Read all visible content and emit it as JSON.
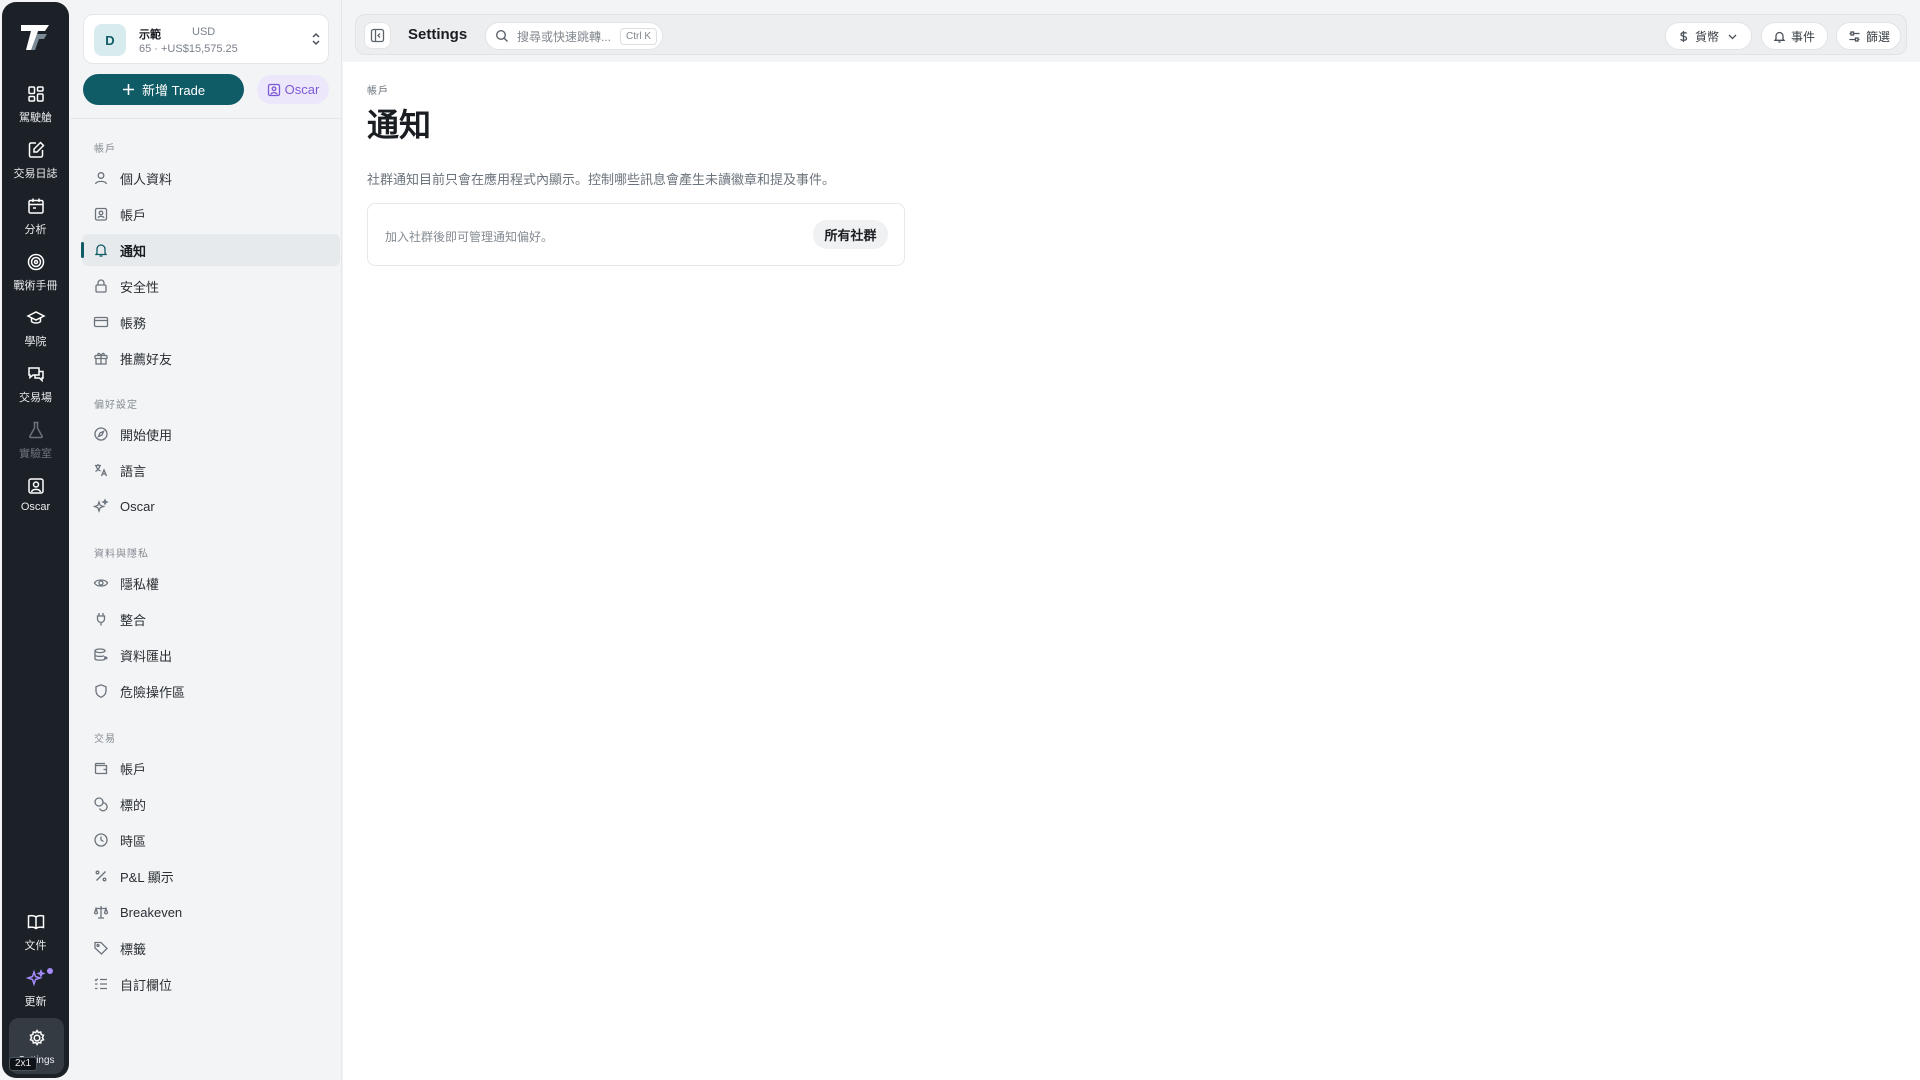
{
  "rail": {
    "items": [
      {
        "label": "駕駛艙",
        "icon": "grid-icon"
      },
      {
        "label": "交易日誌",
        "icon": "journal-edit-icon"
      },
      {
        "label": "分析",
        "icon": "calendar-icon"
      },
      {
        "label": "戰術手冊",
        "icon": "target-icon"
      },
      {
        "label": "學院",
        "icon": "graduation-cap-icon"
      },
      {
        "label": "交易場",
        "icon": "chat-bubbles-icon"
      },
      {
        "label": "實驗室",
        "icon": "flask-icon"
      },
      {
        "label": "Oscar",
        "icon": "assistant-icon"
      }
    ],
    "docs_label": "文件",
    "updates_label": "更新",
    "settings_label": "Settings",
    "zoom_badge": "2x1",
    "accent_color": "#a78bfa"
  },
  "account": {
    "avatar_letter": "D",
    "name": "示範",
    "currency": "USD",
    "balance": "65 · +US$15,575.25"
  },
  "actions": {
    "new_trade": "新增 Trade",
    "oscar": "Oscar"
  },
  "sidebar": {
    "sections": [
      {
        "label": "帳戶",
        "items": [
          {
            "label": "個人資料",
            "icon": "user-icon"
          },
          {
            "label": "帳戶",
            "icon": "id-badge-icon"
          },
          {
            "label": "通知",
            "icon": "bell-icon",
            "active": true
          },
          {
            "label": "安全性",
            "icon": "lock-icon"
          },
          {
            "label": "帳務",
            "icon": "credit-card-icon"
          },
          {
            "label": "推薦好友",
            "icon": "gift-icon"
          }
        ]
      },
      {
        "label": "偏好設定",
        "items": [
          {
            "label": "開始使用",
            "icon": "compass-icon"
          },
          {
            "label": "語言",
            "icon": "translate-icon"
          },
          {
            "label": "Oscar",
            "icon": "sparkles-icon"
          }
        ]
      },
      {
        "label": "資料與隱私",
        "items": [
          {
            "label": "隱私權",
            "icon": "eye-icon"
          },
          {
            "label": "整合",
            "icon": "plug-icon"
          },
          {
            "label": "資料匯出",
            "icon": "database-export-icon"
          },
          {
            "label": "危險操作區",
            "icon": "shield-icon"
          }
        ]
      },
      {
        "label": "交易",
        "items": [
          {
            "label": "帳戶",
            "icon": "wallet-icon"
          },
          {
            "label": "標的",
            "icon": "coins-icon"
          },
          {
            "label": "時區",
            "icon": "clock-icon"
          },
          {
            "label": "P&L 顯示",
            "icon": "percent-icon"
          },
          {
            "label": "Breakeven",
            "icon": "scale-icon"
          },
          {
            "label": "標籤",
            "icon": "tag-icon"
          },
          {
            "label": "自訂欄位",
            "icon": "list-check-icon"
          }
        ]
      }
    ],
    "active_color": "#0f5b66"
  },
  "topbar": {
    "title": "Settings",
    "search_placeholder": "搜尋或快速跳轉...",
    "search_shortcut": "Ctrl K",
    "currency_label": "貨幣",
    "events_label": "事件",
    "filter_label": "篩選"
  },
  "main": {
    "breadcrumb": "帳戶",
    "title": "通知",
    "description": "社群通知目前只會在應用程式內顯示。控制哪些訊息會產生未讀徽章和提及事件。",
    "card_text": "加入社群後即可管理通知偏好。",
    "card_button": "所有社群"
  },
  "colors": {
    "brand": "#0f5b66",
    "rail_bg": "#1c2127",
    "oscar_purple": "#7c5ad6"
  }
}
